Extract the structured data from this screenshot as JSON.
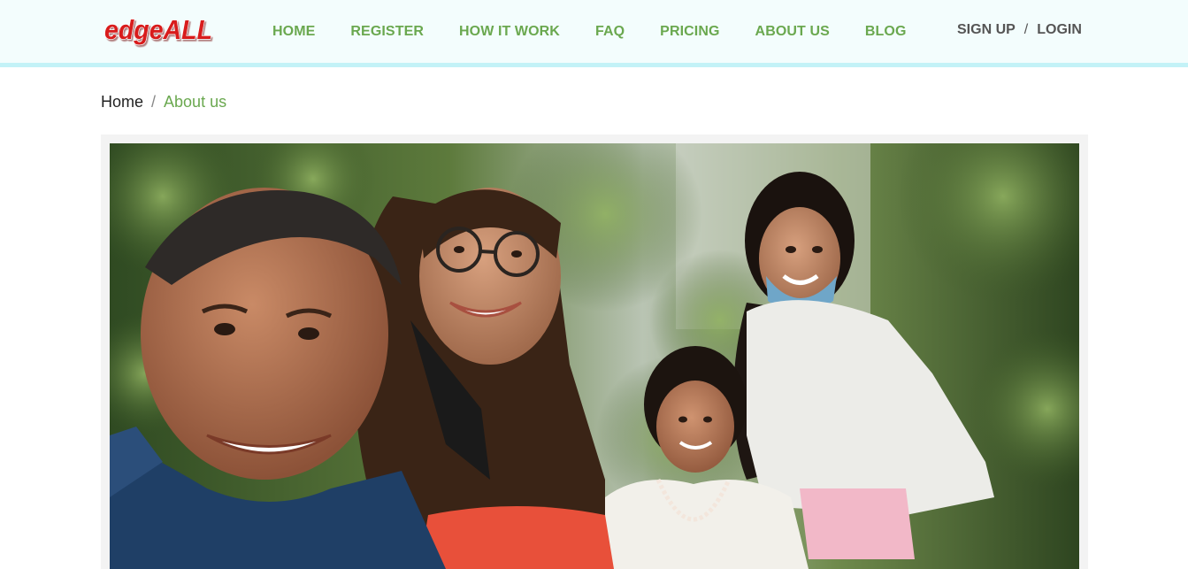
{
  "header": {
    "logo_text": "edgeALL",
    "nav": [
      {
        "label": "HOME"
      },
      {
        "label": "REGISTER"
      },
      {
        "label": "HOW IT WORK"
      },
      {
        "label": "FAQ"
      },
      {
        "label": "PRICING"
      },
      {
        "label": "ABOUT US"
      },
      {
        "label": "BLOG"
      }
    ],
    "auth": {
      "signup_label": "SIGN UP",
      "separator": "/",
      "login_label": "LOGIN"
    }
  },
  "breadcrumb": {
    "home_label": "Home",
    "separator": "/",
    "current_label": "About us"
  },
  "colors": {
    "nav_green": "#6aa84f",
    "logo_red": "#d81e1e",
    "header_bg": "#f3fdfd",
    "header_border": "#c3f2f7",
    "auth_gray": "#555555"
  }
}
